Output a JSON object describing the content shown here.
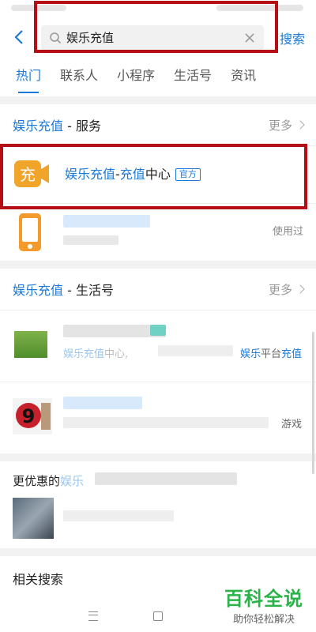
{
  "header": {
    "search_value": "娱乐充值",
    "search_label": "搜索"
  },
  "tabs": [
    {
      "label": "热门"
    },
    {
      "label": "联系人"
    },
    {
      "label": "小程序"
    },
    {
      "label": "生活号"
    },
    {
      "label": "资讯"
    }
  ],
  "services_section": {
    "keyword": "娱乐充值",
    "suffix": " - 服务",
    "more": "更多",
    "item": {
      "keyword1": "娱乐充值",
      "dash": "-",
      "keyword2": "充值",
      "rest": "中心",
      "badge": "官方",
      "icon_char": "充"
    },
    "item2": {
      "status": "使用过"
    }
  },
  "life_section": {
    "keyword": "娱乐充值",
    "suffix": " - 生活号",
    "more": "更多",
    "item1": {
      "desc_start": "娱乐充值",
      "desc_mid": "中心,",
      "desc_end_kw1": "娱乐",
      "desc_end_rest": "平台",
      "desc_end_kw2": "充值"
    },
    "item2": {
      "desc_end": "游戏"
    }
  },
  "deals_section": {
    "title_prefix": "更优惠的",
    "title_kw": "娱乐"
  },
  "related_section": {
    "title": "相关搜索"
  },
  "watermark": {
    "title": "百科全说",
    "subtitle": "助你轻松解决"
  },
  "colors": {
    "accent": "#1a7ad9",
    "highlight_red": "#b50f16",
    "service_icon": "#f0a52a",
    "watermark_green": "#2bb34a"
  }
}
